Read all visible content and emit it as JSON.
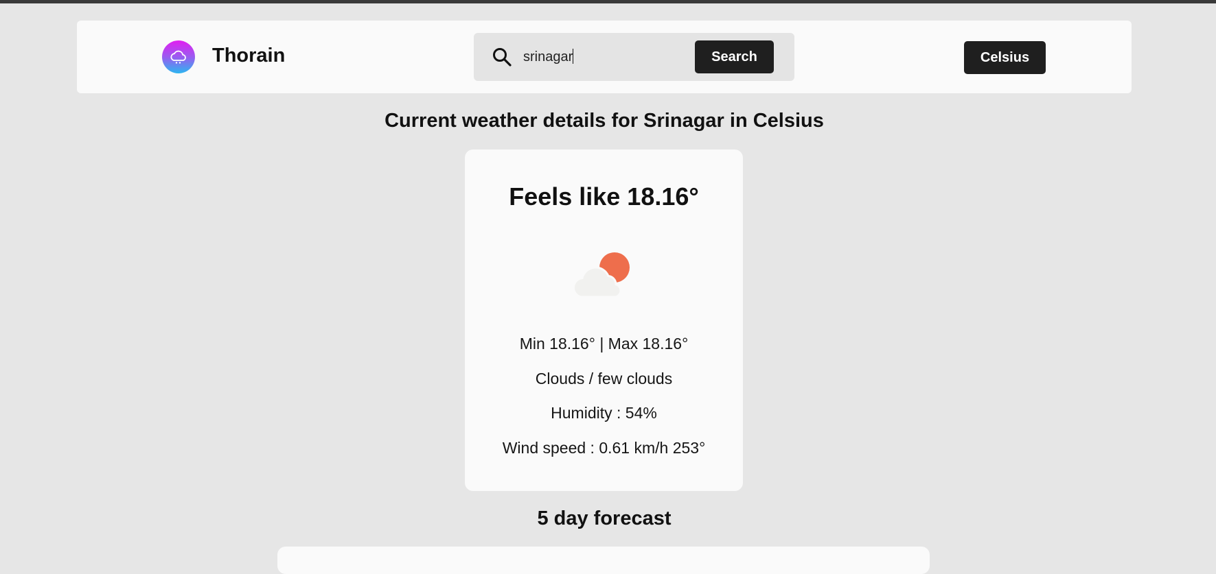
{
  "app": {
    "name": "Thorain"
  },
  "search": {
    "value": "srinagar",
    "button_label": "Search"
  },
  "unit_toggle": {
    "label": "Celsius"
  },
  "current": {
    "heading": "Current weather details for Srinagar in Celsius",
    "feels_like": "Feels like 18.16°",
    "min_max": "Min 18.16° | Max 18.16°",
    "condition": "Clouds / few clouds",
    "humidity": "Humidity : 54%",
    "wind": "Wind speed : 0.61 km/h 253°",
    "icon": "cloud-sun-icon"
  },
  "forecast": {
    "heading": "5 day forecast"
  },
  "colors": {
    "background": "#e6e6e6",
    "panel": "#fafafa",
    "button": "#1f1f1f",
    "sun": "#ee6e4c"
  }
}
